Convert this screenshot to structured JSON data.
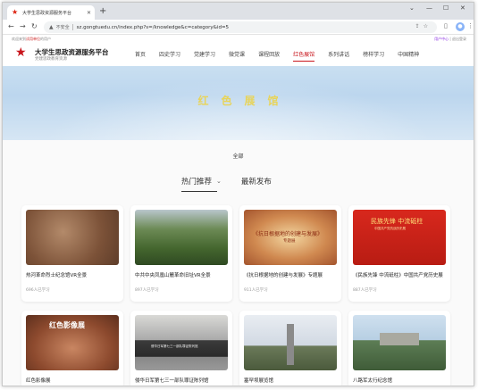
{
  "browser": {
    "tab_title": "大学生思政资源服务平台",
    "url": "sz.gongtuedu.cn/index.php?s=/knowledge&c=category&id=5",
    "insecure_label": "不安全"
  },
  "topbar": {
    "welcome_prefix": "欢迎来到",
    "welcome_highlight": "试用单位",
    "welcome_suffix": "的用户",
    "user_name": "用户中心",
    "logout": "退出登录"
  },
  "header": {
    "site_title": "大学生思政资源服务平台",
    "site_subtitle": "党建思政教育资源",
    "nav": [
      "首页",
      "四史学习",
      "党建学习",
      "微党课",
      "课程回放",
      "红色展馆",
      "系列讲话",
      "榜样学习",
      "中国精神"
    ],
    "active_nav": "红色展馆"
  },
  "banner": {
    "title": "红色展馆"
  },
  "filters": {
    "category_all": "全部",
    "sort_hot": "热门推荐",
    "sort_new": "最新发布"
  },
  "cards": [
    {
      "title": "热河革命烈士纪念馆VR全景",
      "meta": "696人已学习",
      "thumb_text": "",
      "thumb_sub": ""
    },
    {
      "title": "中共中央凤凰山麓革命旧址VR全景",
      "meta": "897人已学习",
      "thumb_text": "",
      "thumb_sub": ""
    },
    {
      "title": "《抗日根据地的创建与发展》专题展",
      "meta": "911人已学习",
      "thumb_text": "《抗日根据地的创建与发展》",
      "thumb_sub": "专题展"
    },
    {
      "title": "《民族先锋 中流砥柱》中国共产党历史展",
      "meta": "887人已学习",
      "thumb_text": "民族先锋 中流砥柱",
      "thumb_sub": "中国共产党抗战历史展"
    },
    {
      "title": "红色影像展",
      "meta": "",
      "thumb_text": "红色影像展",
      "thumb_sub": ""
    },
    {
      "title": "侵华日军第七三一部队罪证陈列馆",
      "meta": "",
      "thumb_text": "侵华日军第七三一部队罪证陈列馆",
      "thumb_sub": ""
    },
    {
      "title": "塞罕坝展览馆",
      "meta": "",
      "thumb_text": "",
      "thumb_sub": ""
    },
    {
      "title": "八路军太行纪念馆",
      "meta": "",
      "thumb_text": "",
      "thumb_sub": ""
    }
  ]
}
